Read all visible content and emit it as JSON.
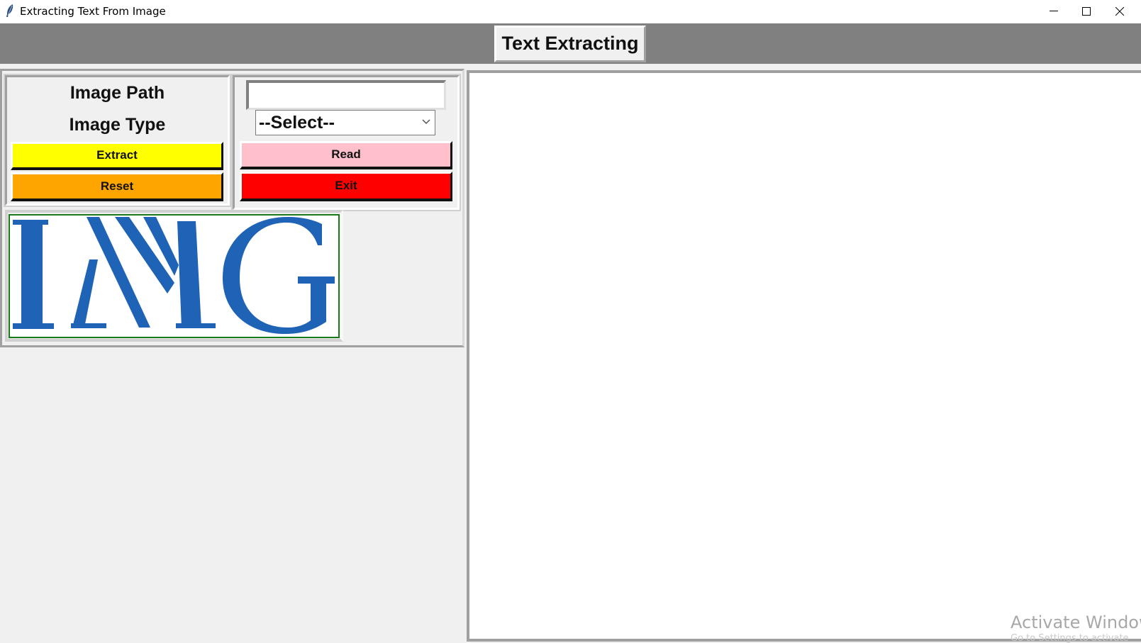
{
  "window": {
    "title": "Extracting Text From Image",
    "controls": [
      "minimize",
      "maximize",
      "close"
    ]
  },
  "header": {
    "title": "Text Extracting"
  },
  "form": {
    "image_path_label": "Image Path",
    "image_type_label": "Image Type",
    "image_path_value": "",
    "image_type_selected": "--Select--"
  },
  "buttons": {
    "extract": {
      "label": "Extract",
      "color": "#ffff00"
    },
    "reset": {
      "label": "Reset",
      "color": "#ffa500"
    },
    "read": {
      "label": "Read",
      "color": "#ffc0cb"
    },
    "exit": {
      "label": "Exit",
      "color": "#ff0000"
    }
  },
  "preview": {
    "logo_text": "IMG",
    "logo_color": "#1e63b6"
  },
  "output": {
    "text": ""
  },
  "watermark": {
    "line1": "Activate Window",
    "line2": "Go to Settings to activate"
  }
}
